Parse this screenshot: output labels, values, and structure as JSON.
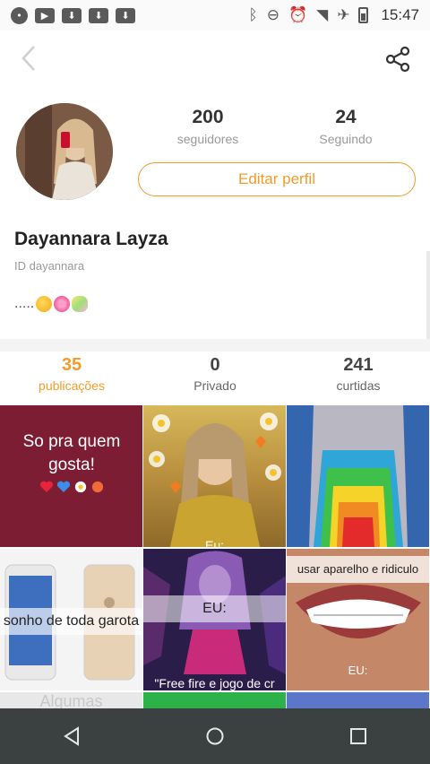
{
  "status_bar": {
    "time": "15:47",
    "left_icons": [
      "chat-icon",
      "youtube-icon",
      "download-icon",
      "download-icon",
      "download-icon"
    ],
    "right_icons": [
      "bluetooth-icon",
      "do-not-disturb-icon",
      "alarm-icon",
      "wifi-icon",
      "airplane-icon",
      "battery-icon"
    ]
  },
  "profile": {
    "followers_count": "200",
    "followers_label": "seguidores",
    "following_count": "24",
    "following_label": "Seguindo",
    "edit_button": "Editar perfil",
    "name": "Dayannara Layza",
    "id_text": "ID dayannara",
    "bio_text": ".....",
    "bio_emojis": [
      "sleepy-face-emoji",
      "lollipop-emoji",
      "candy-emoji"
    ]
  },
  "tabs": [
    {
      "value": "35",
      "label": "publicações",
      "active": true
    },
    {
      "value": "0",
      "label": "Privado",
      "active": false
    },
    {
      "value": "241",
      "label": "curtidas",
      "active": false
    }
  ],
  "posts": [
    {
      "caption": "So pra quem gosta!"
    },
    {
      "caption": "Eu:"
    },
    {
      "caption": ""
    },
    {
      "caption": "sonho de toda garota"
    },
    {
      "caption": "EU:",
      "bottom_caption": "\"Free fire e jogo de cr"
    },
    {
      "caption": "usar aparelho e ridiculo",
      "bottom_caption": "EU:"
    },
    {
      "caption": "Algumas"
    },
    {
      "caption": ""
    },
    {
      "caption": ""
    }
  ],
  "colors": {
    "accent": "#f39b28",
    "navbar": "#3b4141"
  },
  "navigation": [
    "back-icon",
    "home-icon",
    "recents-icon"
  ]
}
